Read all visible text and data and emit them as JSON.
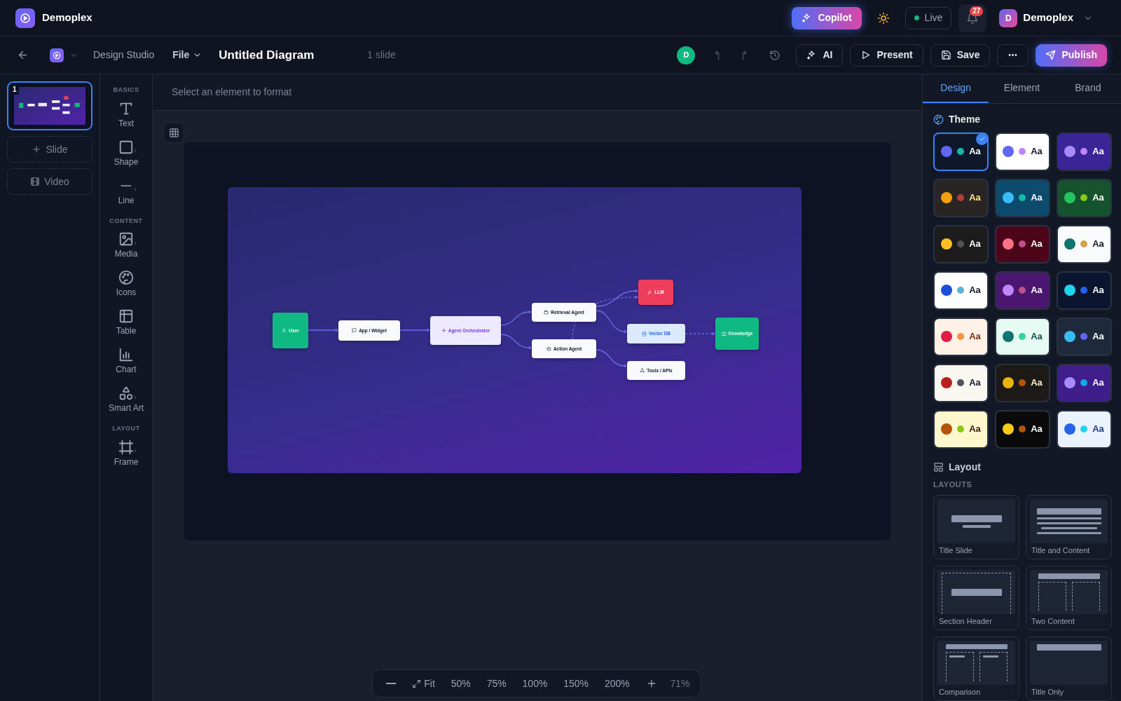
{
  "app": {
    "name": "Demoplex"
  },
  "header": {
    "copilot": "Copilot",
    "status": {
      "label": "Live",
      "on": true
    },
    "notifications": {
      "count": "27"
    },
    "user": {
      "initial": "D",
      "name": "Demoplex"
    }
  },
  "toolbar": {
    "section": "Design Studio",
    "file_menu": "File",
    "title": "Untitled Diagram",
    "slide_count": "1 slide",
    "collaborator": {
      "initial": "D"
    },
    "undo": {
      "disabled": true
    },
    "redo": {
      "disabled": true
    },
    "buttons": [
      {
        "label": "AI",
        "kind": "ai"
      },
      {
        "label": "Present",
        "kind": "present"
      },
      {
        "label": "Save",
        "kind": "save"
      },
      {
        "kind": "more"
      },
      {
        "label": "Publish",
        "kind": "publish"
      }
    ]
  },
  "slides": [
    {
      "number": "1",
      "selected": true
    }
  ],
  "slide_actions": [
    {
      "label": "Slide",
      "kind": "add"
    },
    {
      "label": "Video",
      "kind": "video"
    }
  ],
  "tools": [
    {
      "section": "BASICS",
      "items": [
        {
          "label": "Text",
          "submenu": false
        },
        {
          "label": "Shape",
          "submenu": true
        },
        {
          "label": "Line",
          "submenu": true
        }
      ]
    },
    {
      "section": "CONTENT",
      "items": [
        {
          "label": "Media",
          "submenu": true
        },
        {
          "label": "Icons",
          "submenu": false
        },
        {
          "label": "Table",
          "submenu": false
        },
        {
          "label": "Chart",
          "submenu": false
        },
        {
          "label": "Smart Art",
          "submenu": true
        }
      ]
    },
    {
      "section": "LAYOUT",
      "items": [
        {
          "label": "Frame",
          "submenu": true
        }
      ]
    }
  ],
  "format_hint": "Select an element to format",
  "diagram": {
    "nodes": [
      {
        "label": "User",
        "kind": "endpoint"
      },
      {
        "label": "App / Widget",
        "kind": "service"
      },
      {
        "label": "Agent Orchestrator",
        "kind": "orchestrator"
      },
      {
        "label": "Retrieval Agent",
        "kind": "service"
      },
      {
        "label": "Action Agent",
        "kind": "service"
      },
      {
        "label": "LLM",
        "kind": "model"
      },
      {
        "label": "Vector DB",
        "kind": "store"
      },
      {
        "label": "Tools / APIs",
        "kind": "service"
      },
      {
        "label": "Knowledge",
        "kind": "endpoint"
      }
    ]
  },
  "zoom": {
    "controls": [
      {
        "kind": "out"
      },
      {
        "label": "Fit",
        "kind": "fit"
      },
      {
        "label": "50%",
        "kind": "preset"
      },
      {
        "label": "75%",
        "kind": "preset"
      },
      {
        "label": "100%",
        "kind": "preset"
      },
      {
        "label": "150%",
        "kind": "preset"
      },
      {
        "label": "200%",
        "kind": "preset"
      },
      {
        "kind": "in"
      }
    ],
    "current": "71%"
  },
  "panel": {
    "tabs": [
      {
        "label": "Design",
        "selected": true
      },
      {
        "label": "Element",
        "selected": false
      },
      {
        "label": "Brand",
        "selected": false
      }
    ],
    "theme": {
      "title": "Theme",
      "themes": [
        {
          "selected": true,
          "card": {
            "color": "#0f172a"
          },
          "dots": [
            {
              "color": "#6366f1"
            },
            {
              "color": "#14b8a6"
            }
          ],
          "sample": {
            "label": "Aa",
            "color": "#ffffff"
          }
        },
        {
          "selected": false,
          "card": {
            "color": "#ffffff"
          },
          "dots": [
            {
              "color": "#6366f1"
            },
            {
              "color": "#c084fc"
            }
          ],
          "sample": {
            "label": "Aa",
            "color": "#111827"
          }
        },
        {
          "selected": false,
          "card": {
            "color": "#3b2596"
          },
          "dots": [
            {
              "color": "#a78bfa"
            },
            {
              "color": "#c084fc"
            }
          ],
          "sample": {
            "label": "Aa",
            "color": "#ffffff"
          }
        },
        {
          "selected": false,
          "card": {
            "color": "#292524"
          },
          "dots": [
            {
              "color": "#f59e0b"
            },
            {
              "color": "#b43c3c"
            }
          ],
          "sample": {
            "label": "Aa",
            "color": "#fde68a"
          }
        },
        {
          "selected": false,
          "card": {
            "color": "#0c4a6e"
          },
          "dots": [
            {
              "color": "#38bdf8"
            },
            {
              "color": "#14b8a6"
            }
          ],
          "sample": {
            "label": "Aa",
            "color": "#ffffff"
          }
        },
        {
          "selected": false,
          "card": {
            "color": "#14532d"
          },
          "dots": [
            {
              "color": "#22c55e"
            },
            {
              "color": "#84cc16"
            }
          ],
          "sample": {
            "label": "Aa",
            "color": "#ffffff"
          }
        },
        {
          "selected": false,
          "card": {
            "color": "#1c1c1c"
          },
          "dots": [
            {
              "color": "#fbbf24"
            },
            {
              "color": "#52525b"
            }
          ],
          "sample": {
            "label": "Aa",
            "color": "#ffffff"
          }
        },
        {
          "selected": false,
          "card": {
            "color": "#4c0519"
          },
          "dots": [
            {
              "color": "#fb7185"
            },
            {
              "color": "#c0508a"
            }
          ],
          "sample": {
            "label": "Aa",
            "color": "#ffffff"
          }
        },
        {
          "selected": false,
          "card": {
            "color": "#f8fafc"
          },
          "dots": [
            {
              "color": "#0f766e"
            },
            {
              "color": "#d4a24c"
            }
          ],
          "sample": {
            "label": "Aa",
            "color": "#111827"
          }
        },
        {
          "selected": false,
          "card": {
            "color": "#ffffff"
          },
          "dots": [
            {
              "color": "#1d4ed8"
            },
            {
              "color": "#5ab4d6"
            }
          ],
          "sample": {
            "label": "Aa",
            "color": "#111827"
          }
        },
        {
          "selected": false,
          "card": {
            "color": "#4a1670"
          },
          "dots": [
            {
              "color": "#c084fc"
            },
            {
              "color": "#c0508a"
            }
          ],
          "sample": {
            "label": "Aa",
            "color": "#ffffff"
          }
        },
        {
          "selected": false,
          "card": {
            "color": "#0b1530"
          },
          "dots": [
            {
              "color": "#22d3ee"
            },
            {
              "color": "#2563eb"
            }
          ],
          "sample": {
            "label": "Aa",
            "color": "#ffffff"
          }
        },
        {
          "selected": false,
          "card": {
            "color": "#fff1e6"
          },
          "dots": [
            {
              "color": "#e11d48"
            },
            {
              "color": "#fb923c"
            }
          ],
          "sample": {
            "label": "Aa",
            "color": "#7c2d12"
          }
        },
        {
          "selected": false,
          "card": {
            "color": "#e6fbf3"
          },
          "dots": [
            {
              "color": "#0f766e"
            },
            {
              "color": "#34d399"
            }
          ],
          "sample": {
            "label": "Aa",
            "color": "#134e4a"
          }
        },
        {
          "selected": false,
          "card": {
            "color": "#1e293b"
          },
          "dots": [
            {
              "color": "#38bdf8"
            },
            {
              "color": "#6366f1"
            }
          ],
          "sample": {
            "label": "Aa",
            "color": "#ffffff"
          }
        },
        {
          "selected": false,
          "card": {
            "color": "#faf7f0"
          },
          "dots": [
            {
              "color": "#b91c1c"
            },
            {
              "color": "#52525b"
            }
          ],
          "sample": {
            "label": "Aa",
            "color": "#111827"
          }
        },
        {
          "selected": false,
          "card": {
            "color": "#1c1917"
          },
          "dots": [
            {
              "color": "#eab308"
            },
            {
              "color": "#b45309"
            }
          ],
          "sample": {
            "label": "Aa",
            "color": "#fef3c7"
          }
        },
        {
          "selected": false,
          "card": {
            "color": "#3f1d8a"
          },
          "dots": [
            {
              "color": "#a78bfa"
            },
            {
              "color": "#0ea5e9"
            }
          ],
          "sample": {
            "label": "Aa",
            "color": "#ffffff"
          }
        },
        {
          "selected": false,
          "card": {
            "color": "#fef7cd"
          },
          "dots": [
            {
              "color": "#b45309"
            },
            {
              "color": "#84cc16"
            }
          ],
          "sample": {
            "label": "Aa",
            "color": "#3b1a0a"
          }
        },
        {
          "selected": false,
          "card": {
            "color": "#0a0a0a"
          },
          "dots": [
            {
              "color": "#facc15"
            },
            {
              "color": "#b45309"
            }
          ],
          "sample": {
            "label": "Aa",
            "color": "#ffffff"
          }
        },
        {
          "selected": false,
          "card": {
            "color": "#eaf2fe"
          },
          "dots": [
            {
              "color": "#2563eb"
            },
            {
              "color": "#22d3ee"
            }
          ],
          "sample": {
            "label": "Aa",
            "color": "#1e3a8a"
          }
        }
      ]
    },
    "layout": {
      "title": "Layout",
      "subtitle": "LAYOUTS",
      "layouts": [
        {
          "label": "Title Slide",
          "kind": "title"
        },
        {
          "label": "Title and Content",
          "kind": "content"
        },
        {
          "label": "Section Header",
          "kind": "section"
        },
        {
          "label": "Two Content",
          "kind": "two"
        },
        {
          "label": "Comparison",
          "kind": "comparison"
        },
        {
          "label": "Title Only",
          "kind": "title_only"
        }
      ]
    }
  }
}
